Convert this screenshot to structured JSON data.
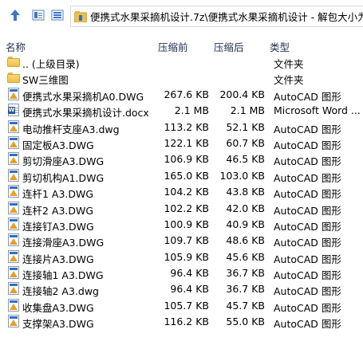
{
  "toolbar": {
    "address": "便携式水果采摘机设计.7z\\便携式水果采摘机设计 - 解包大小为"
  },
  "columns": {
    "name": "名称",
    "size_before": "压缩前",
    "size_after": "压缩后",
    "type": "类型"
  },
  "colors": {
    "folder": "#eebf48",
    "dwg_bar": "#2d6fc4",
    "dwg_triangle": "#e5a02a",
    "word": "#2b5797"
  },
  "rows": [
    {
      "icon": "folder-icon",
      "name": ".. (上级目录)",
      "before": "",
      "after": "",
      "type": "文件夹"
    },
    {
      "icon": "folder-icon",
      "name": "SW三维图",
      "before": "",
      "after": "",
      "type": "文件夹"
    },
    {
      "icon": "dwg-file-icon",
      "name": "便携式水果采摘机A0.DWG",
      "before": "267.6 KB",
      "after": "200.4 KB",
      "type": "AutoCAD 图形"
    },
    {
      "icon": "word-doc-icon",
      "name": "便携式水果采摘机设计.docx",
      "before": "2.1 MB",
      "after": "2.1 MB",
      "type": "Microsoft Word ..."
    },
    {
      "icon": "dwg-file-icon",
      "name": "电动推杆支座A3.dwg",
      "before": "113.2 KB",
      "after": "52.1 KB",
      "type": "AutoCAD 图形"
    },
    {
      "icon": "dwg-file-icon",
      "name": "固定板A3.DWG",
      "before": "122.1 KB",
      "after": "60.7 KB",
      "type": "AutoCAD 图形"
    },
    {
      "icon": "dwg-file-icon",
      "name": "剪切滑座A3.DWG",
      "before": "106.9 KB",
      "after": "46.5 KB",
      "type": "AutoCAD 图形"
    },
    {
      "icon": "dwg-file-icon",
      "name": "剪切机构A1.DWG",
      "before": "165.0 KB",
      "after": "103.0 KB",
      "type": "AutoCAD 图形"
    },
    {
      "icon": "dwg-file-icon",
      "name": "连杆1 A3.DWG",
      "before": "104.2 KB",
      "after": "43.8 KB",
      "type": "AutoCAD 图形"
    },
    {
      "icon": "dwg-file-icon",
      "name": "连杆2 A3.DWG",
      "before": "102.2 KB",
      "after": "42.0 KB",
      "type": "AutoCAD 图形"
    },
    {
      "icon": "dwg-file-icon",
      "name": "连接钉A3.DWG",
      "before": "100.9 KB",
      "after": "40.9 KB",
      "type": "AutoCAD 图形"
    },
    {
      "icon": "dwg-file-icon",
      "name": "连接滑座A3.DWG",
      "before": "109.7 KB",
      "after": "48.6 KB",
      "type": "AutoCAD 图形"
    },
    {
      "icon": "dwg-file-icon",
      "name": "连接片A3.DWG",
      "before": "105.9 KB",
      "after": "45.6 KB",
      "type": "AutoCAD 图形"
    },
    {
      "icon": "dwg-file-icon",
      "name": "连接轴1 A3.DWG",
      "before": "96.4 KB",
      "after": "36.7 KB",
      "type": "AutoCAD 图形"
    },
    {
      "icon": "dwg-file-icon",
      "name": "连接轴2 A3.dwg",
      "before": "96.4 KB",
      "after": "36.7 KB",
      "type": "AutoCAD 图形"
    },
    {
      "icon": "dwg-file-icon",
      "name": "收集盘A3.DWG",
      "before": "105.7 KB",
      "after": "45.7 KB",
      "type": "AutoCAD 图形"
    },
    {
      "icon": "dwg-file-icon",
      "name": "支撑架A3.DWG",
      "before": "116.2 KB",
      "after": "55.0 KB",
      "type": "AutoCAD 图形"
    }
  ]
}
